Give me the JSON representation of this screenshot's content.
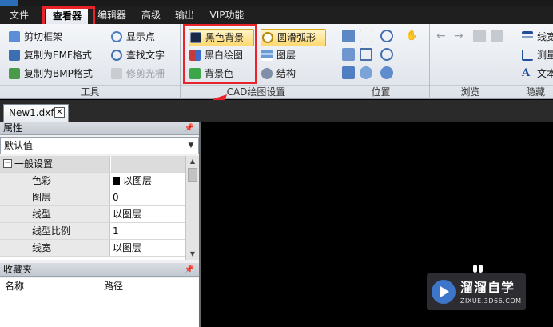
{
  "menu": {
    "items": [
      {
        "label": "文件"
      },
      {
        "label": "查看器"
      },
      {
        "label": "编辑器"
      },
      {
        "label": "高级"
      },
      {
        "label": "输出"
      },
      {
        "label": "VIP功能"
      }
    ]
  },
  "ribbon": {
    "tools": {
      "label": "工具",
      "buttons": [
        "剪切框架",
        "复制为EMF格式",
        "复制为BMP格式",
        "显示点",
        "查找文字",
        "修剪光栅"
      ]
    },
    "cad_settings": {
      "label": "CAD绘图设置",
      "buttons": [
        "黑色背景",
        "黑白绘图",
        "背景色",
        "圆滑弧形",
        "图层",
        "结构"
      ]
    },
    "position": {
      "label": "位置"
    },
    "browse": {
      "label": "浏览"
    },
    "hide": {
      "label": "隐藏",
      "buttons": [
        "线宽",
        "测量",
        "文本"
      ]
    }
  },
  "document_tab": {
    "label": "New1.dxf"
  },
  "properties": {
    "title": "属性",
    "default_value": "默认值",
    "section": "一般设置",
    "rows": [
      {
        "key": "色彩",
        "value": "以图层"
      },
      {
        "key": "图层",
        "value": "0"
      },
      {
        "key": "线型",
        "value": "以图层"
      },
      {
        "key": "线型比例",
        "value": "1"
      },
      {
        "key": "线宽",
        "value": "以图层"
      }
    ]
  },
  "favorites": {
    "title": "收藏夹",
    "columns": [
      "名称",
      "路径"
    ]
  },
  "watermark": {
    "title": "溜溜自学",
    "subtitle": "ZIXUE.3D66.COM"
  },
  "colors": {
    "highlight_box": "#e8232a",
    "canvas": "#000000",
    "menubar": "#1f1f1f"
  }
}
